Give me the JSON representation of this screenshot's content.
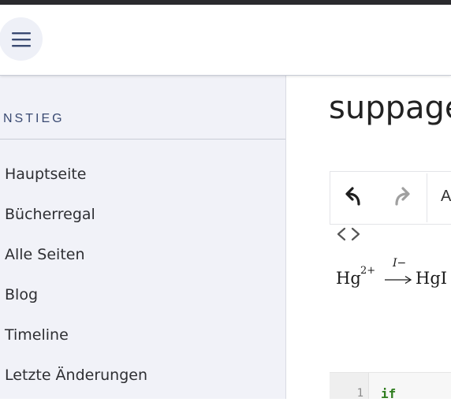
{
  "header": {
    "menu_icon": "hamburger-menu-icon"
  },
  "sidebar": {
    "section_title": "NSTIEG",
    "items": [
      {
        "label": "Hauptseite"
      },
      {
        "label": "Bücherregal"
      },
      {
        "label": "Alle Seiten"
      },
      {
        "label": "Blog"
      },
      {
        "label": "Timeline"
      },
      {
        "label": "Letzte Änderungen"
      }
    ]
  },
  "main": {
    "title": "suppage",
    "toolbar": {
      "undo_icon": "undo-icon",
      "redo_icon": "redo-icon",
      "format_label": "A"
    },
    "source_toggle_icon": "code-brackets-icon",
    "formula": {
      "base1": "Hg",
      "sup1": "2+",
      "over_arrow": "I−",
      "base2": "HgI"
    },
    "code": {
      "line_number": "1",
      "keyword": "if"
    }
  },
  "colors": {
    "sidebar_bg": "#f1f2f8",
    "section_title": "#3a4a72",
    "keyword": "#2f7d1e",
    "redo_disabled": "#a0a0a0"
  }
}
